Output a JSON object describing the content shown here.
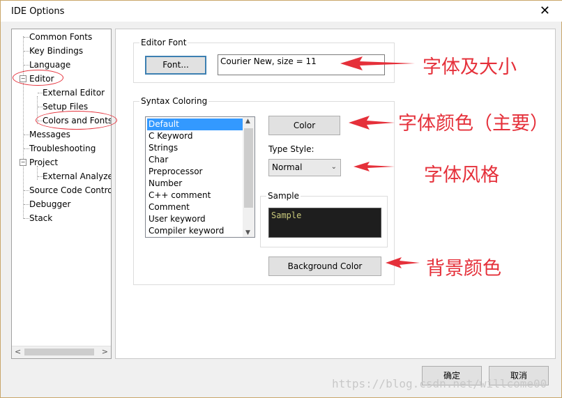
{
  "window": {
    "title": "IDE Options",
    "close_glyph": "✕"
  },
  "tree": {
    "items": [
      {
        "label": "Common Fonts"
      },
      {
        "label": "Key Bindings"
      },
      {
        "label": "Language"
      },
      {
        "label": "Editor"
      },
      {
        "label": "External Editor"
      },
      {
        "label": "Setup Files"
      },
      {
        "label": "Colors and Fonts"
      },
      {
        "label": "Messages"
      },
      {
        "label": "Troubleshooting"
      },
      {
        "label": "Project"
      },
      {
        "label": "External Analyzer"
      },
      {
        "label": "Source Code Control"
      },
      {
        "label": "Debugger"
      },
      {
        "label": "Stack"
      }
    ],
    "expander_glyph": "−"
  },
  "editor_font": {
    "legend": "Editor Font",
    "font_button": "Font...",
    "current_font": "Courier New, size = 11"
  },
  "syntax": {
    "legend": "Syntax Coloring",
    "items": [
      "Default",
      "C Keyword",
      "Strings",
      "Char",
      "Preprocessor",
      "Number",
      "C++ comment",
      "Comment",
      "User keyword",
      "Compiler keyword"
    ],
    "selected": "Default",
    "color_button": "Color",
    "type_style_label": "Type Style:",
    "type_style_value": "Normal",
    "sample_legend": "Sample",
    "sample_text": "Sample",
    "background_button": "Background Color"
  },
  "annotations": {
    "font_size": "字体及大小",
    "font_color": "字体颜色（主要）",
    "font_style": "字体风格",
    "bg_color": "背景颜色"
  },
  "footer": {
    "ok": "确定",
    "cancel": "取消"
  },
  "watermark": "https://blog.csdn.net/willcome00",
  "colors": {
    "accent": "#3399ff",
    "annotation": "#e5303a"
  }
}
